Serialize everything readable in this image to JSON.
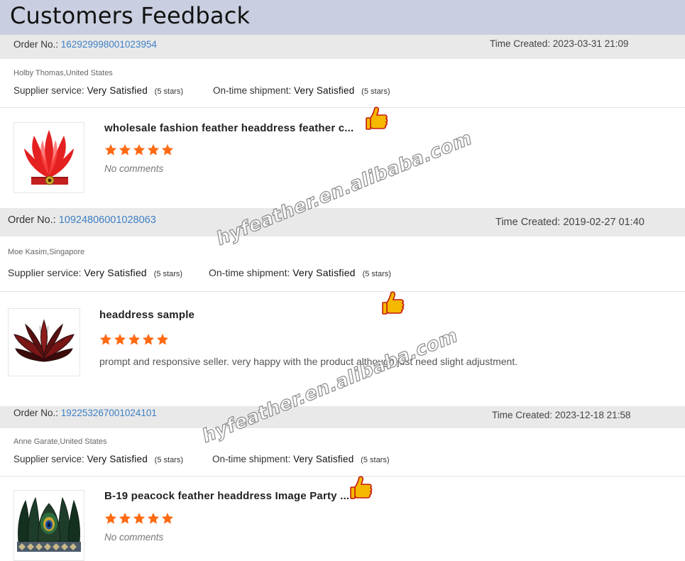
{
  "page": {
    "title": "Customers Feedback"
  },
  "labels": {
    "order_no": "Order No.:",
    "time_created": "Time Created:",
    "supplier_service": "Supplier service:",
    "on_time_shipment": "On-time shipment:"
  },
  "colors": {
    "header_bg": "#c9cfe0",
    "band_bg": "#e9e9e9",
    "link": "#3d7fc4",
    "star": "#ff6a13",
    "thumb_icon": "#f6b800"
  },
  "watermark": "hyfeather.en.alibaba.com",
  "orders": [
    {
      "order_number": "162929998001023954",
      "time_created": "2023-03-31 21:09",
      "buyer": "Holby Thomas,United States",
      "supplier_value": "Very Satisfied",
      "supplier_stars": "(5 stars)",
      "shipment_value": "Very Satisfied",
      "shipment_stars": "(5 stars)",
      "product_title": "wholesale fashion feather headdress feather c...",
      "rating": 5,
      "comment": "No comments",
      "image_icon": "red-feather-headband-image"
    },
    {
      "order_number": "10924806001028063",
      "time_created": "2019-02-27 01:40",
      "buyer": "Moe Kasim,Singapore",
      "supplier_value": "Very Satisfied",
      "supplier_stars": "(5 stars)",
      "shipment_value": "Very Satisfied",
      "shipment_stars": "(5 stars)",
      "product_title": "headdress sample",
      "rating": 5,
      "comment": "prompt and responsive seller. very happy with the product although just need slight adjustment.",
      "image_icon": "dark-red-feather-headdress-image"
    },
    {
      "order_number": "192253267001024101",
      "time_created": "2023-12-18 21:58",
      "buyer": "Anne Garate,United States",
      "supplier_value": "Very Satisfied",
      "supplier_stars": "(5 stars)",
      "shipment_value": "Very Satisfied",
      "shipment_stars": "(5 stars)",
      "product_title": "B-19 peacock feather headdress Image Party ...",
      "rating": 5,
      "comment": "No comments",
      "image_icon": "peacock-feather-headdress-image"
    }
  ]
}
